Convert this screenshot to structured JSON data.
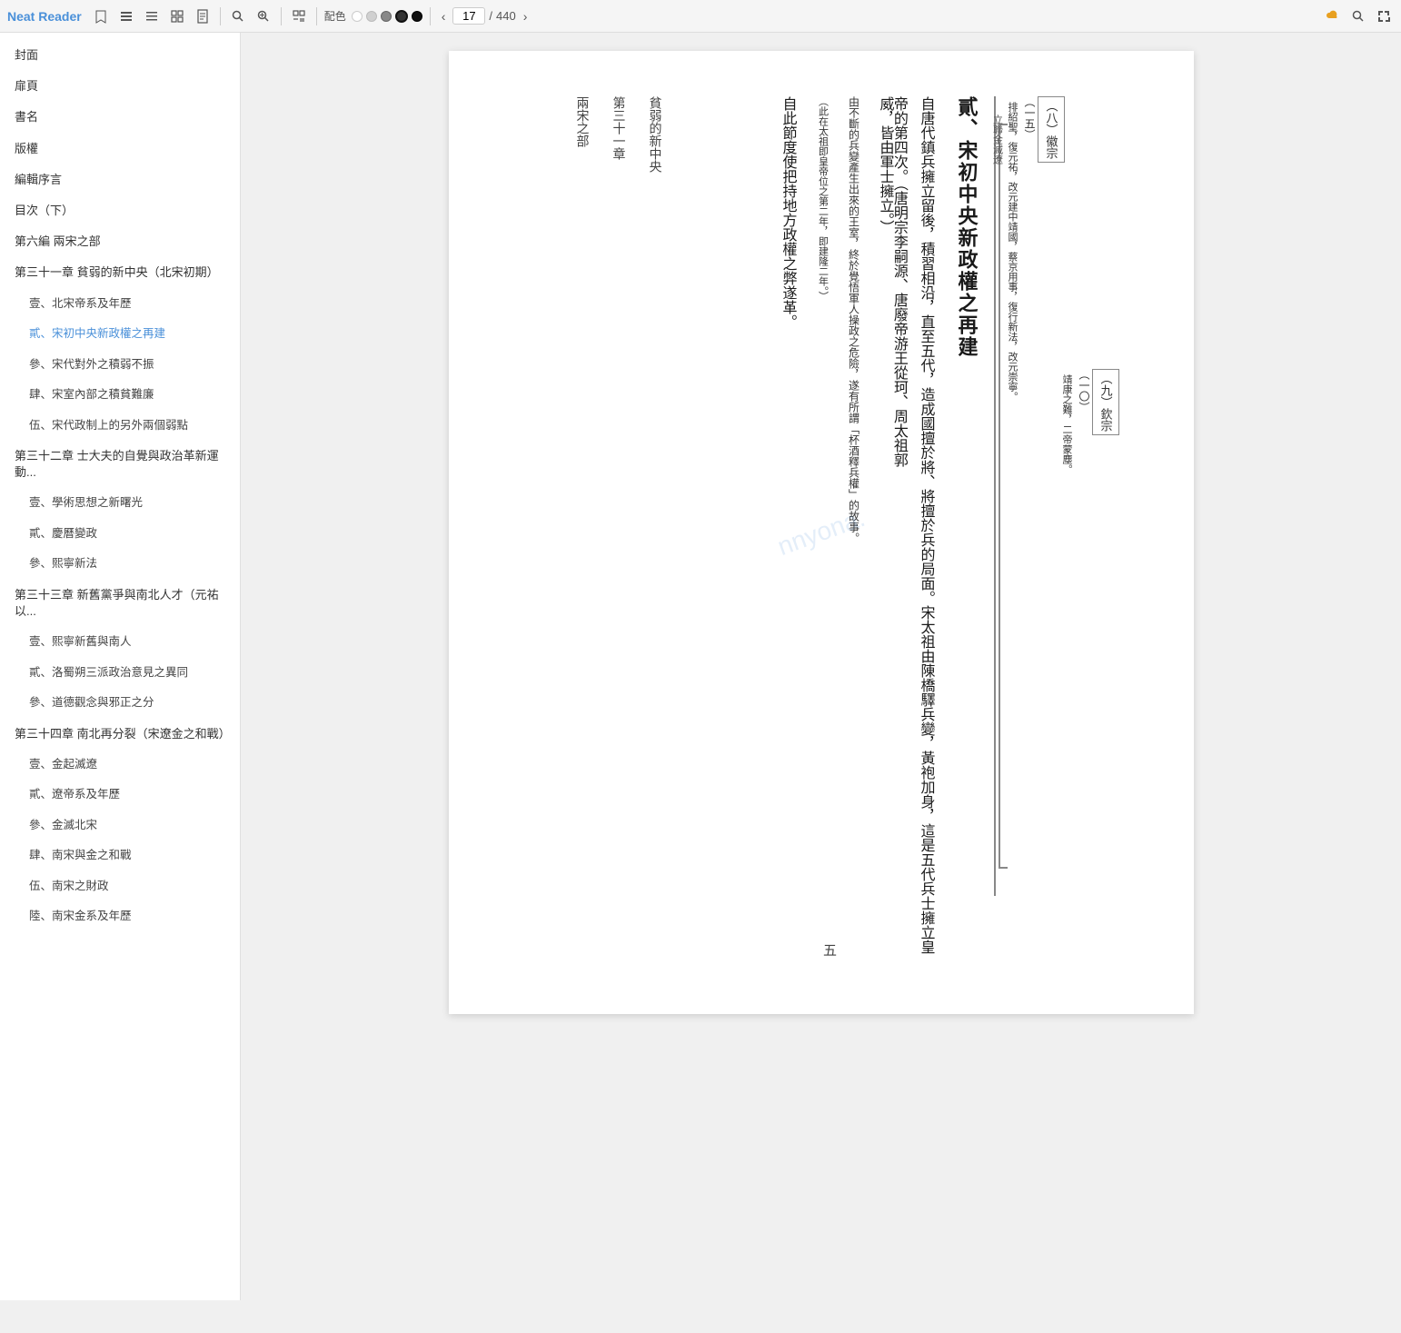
{
  "app": {
    "title": "Neat Reader"
  },
  "toolbar": {
    "icons": [
      "bookmark",
      "layers",
      "menu",
      "grid",
      "doc",
      "search",
      "search2",
      "expand"
    ],
    "color_options": [
      "white",
      "light",
      "dark",
      "darker",
      "black"
    ],
    "color_active_index": 3,
    "page_current": "17",
    "page_total": "440",
    "right_icons": [
      "cloud",
      "search",
      "fit"
    ]
  },
  "sidebar": {
    "items": [
      {
        "id": "cover",
        "label": "封面",
        "level": "top"
      },
      {
        "id": "preface",
        "label": "扉頁",
        "level": "top"
      },
      {
        "id": "bookname",
        "label": "書名",
        "level": "top"
      },
      {
        "id": "copyright",
        "label": "版權",
        "level": "top"
      },
      {
        "id": "editorial",
        "label": "編輯序言",
        "level": "top"
      },
      {
        "id": "toc",
        "label": "目次（下）",
        "level": "top"
      },
      {
        "id": "part6",
        "label": "第六編 兩宋之部",
        "level": "top"
      },
      {
        "id": "ch31",
        "label": "第三十一章 貧弱的新中央（北宋初期）",
        "level": "chapter"
      },
      {
        "id": "ch31-1",
        "label": "壹、北宋帝系及年歷",
        "level": "sub"
      },
      {
        "id": "ch31-2",
        "label": "貳、宋初中央新政權之再建",
        "level": "sub",
        "active": true
      },
      {
        "id": "ch31-3",
        "label": "參、宋代對外之積弱不振",
        "level": "sub"
      },
      {
        "id": "ch31-4",
        "label": "肆、宋室內部之積貧難廉",
        "level": "sub"
      },
      {
        "id": "ch31-5",
        "label": "伍、宋代政制上的另外兩個弱點",
        "level": "sub"
      },
      {
        "id": "ch32",
        "label": "第三十二章 士大夫的自覺與政治革新運動...",
        "level": "chapter"
      },
      {
        "id": "ch32-1",
        "label": "壹、學術思想之新曙光",
        "level": "sub"
      },
      {
        "id": "ch32-2",
        "label": "貳、慶曆變政",
        "level": "sub"
      },
      {
        "id": "ch32-3",
        "label": "參、熙寧新法",
        "level": "sub"
      },
      {
        "id": "ch33",
        "label": "第三十三章 新舊黨爭與南北人才（元祐以...",
        "level": "chapter"
      },
      {
        "id": "ch33-1",
        "label": "壹、熙寧新舊與南人",
        "level": "sub"
      },
      {
        "id": "ch33-2",
        "label": "貳、洛蜀朔三派政治意見之異同",
        "level": "sub"
      },
      {
        "id": "ch33-3",
        "label": "參、道德觀念與邪正之分",
        "level": "sub"
      },
      {
        "id": "ch34",
        "label": "第三十四章 南北再分裂（宋遼金之和戰）",
        "level": "chapter"
      },
      {
        "id": "ch34-1",
        "label": "壹、金起滅遼",
        "level": "sub"
      },
      {
        "id": "ch34-2",
        "label": "貳、遼帝系及年歷",
        "level": "sub"
      },
      {
        "id": "ch34-3",
        "label": "參、金滅北宋",
        "level": "sub"
      },
      {
        "id": "ch34-4",
        "label": "肆、南宋與金之和戰",
        "level": "sub"
      },
      {
        "id": "ch34-5",
        "label": "伍、南宋之財政",
        "level": "sub"
      },
      {
        "id": "ch34-6",
        "label": "陸、南宋金系及年歷",
        "level": "sub"
      }
    ]
  },
  "page": {
    "number": "五",
    "content": {
      "part_label": "兩宋之部",
      "chapter_label": "第三十一章",
      "chapter_sub": "貧弱的新中央",
      "section_title": "貳、宋初中央新政權之再建",
      "main_text_1": "自唐代鎮兵擁立留後，積習相沿，直至五代，造成國擅於將、將擅於兵的局面。宋太祖由陳橋驛兵變，黃袍加身，這是五代兵士擁立皇帝的第四次。（唐明宗李嗣源、唐廢帝游王從珂、周太祖郭",
      "main_text_2": "自此節度使把持地方政權之弊遂革。",
      "annotation_1": "（此在太祖即皇帝位之第二年，即建隆二年。）",
      "annotation_2": "由不斷的兵變產生出來的王室，終於覺悟軍人操政之危險，遂有所謂「杯酒釋兵權」的故事。",
      "annotation_3": "（此在太祖即皇帝位之第二年，即建隆二年。）",
      "watermark": "nnyona."
    },
    "lineage": {
      "left_bracket": "一",
      "emperor_8": {
        "label": "（八）徽宗",
        "num": "（一五）",
        "note1": "排紹聖，復元祐，",
        "note2": "改元建中靖國，",
        "note3": "蔡京用事，復行新法，",
        "note4": "改元崇寧。"
      },
      "emperor_9": {
        "label": "（九）欽宗",
        "num": "（一〇）",
        "note": "靖康之難，二帝蒙塵。"
      },
      "line_labels": [
        "立",
        "聯金滅遼",
        "蔡京用事",
        "改元建中靖國",
        "復行新法",
        "改元崇寧",
        "排紹聖",
        "復元祐"
      ]
    }
  }
}
